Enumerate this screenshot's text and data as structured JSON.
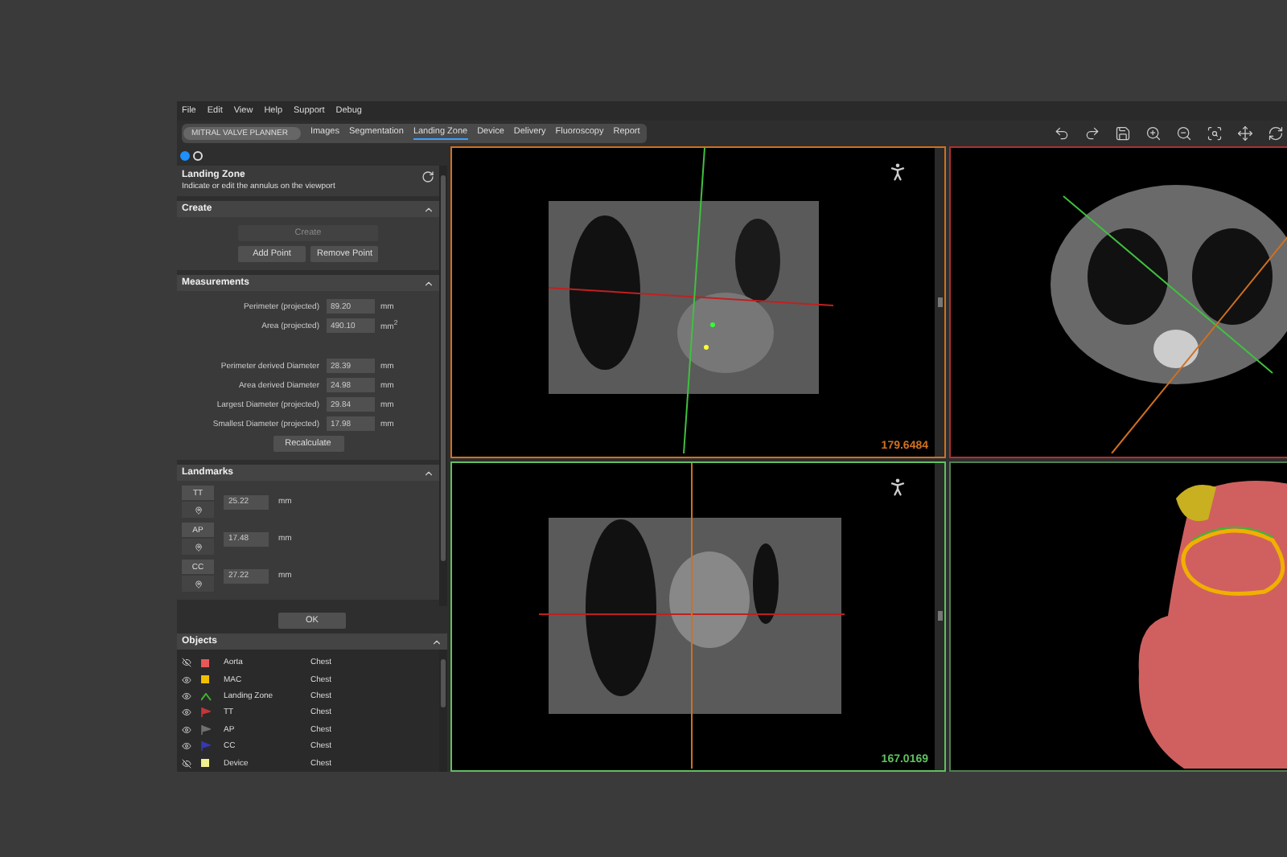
{
  "menu": [
    "File",
    "Edit",
    "View",
    "Help",
    "Support",
    "Debug"
  ],
  "workflow": {
    "title": "MITRAL VALVE PLANNER",
    "tabs": [
      {
        "label": "Images",
        "selected": false
      },
      {
        "label": "Segmentation",
        "selected": false
      },
      {
        "label": "Landing Zone",
        "selected": true
      },
      {
        "label": "Device",
        "selected": false
      },
      {
        "label": "Delivery",
        "selected": false
      },
      {
        "label": "Fluoroscopy",
        "selected": false
      },
      {
        "label": "Report",
        "selected": false
      }
    ]
  },
  "steps": [
    {
      "selected": true
    },
    {
      "selected": false
    }
  ],
  "panel": {
    "title": "Landing Zone",
    "subtitle": "Indicate or edit the annulus on the viewport"
  },
  "create": {
    "title": "Create",
    "expanded": true,
    "create_button": {
      "label": "Create",
      "disabled": true
    },
    "buttons": [
      "Add Point",
      "Remove Point"
    ]
  },
  "measurements": {
    "title": "Measurements",
    "expanded": true,
    "groups": [
      [
        {
          "label": "Perimeter (projected)",
          "value": "89.20",
          "unit": "mm"
        },
        {
          "label": "Area (projected)",
          "value": "490.10",
          "unit": "mm$^{2}$"
        }
      ],
      [
        {
          "label": "Perimeter derived Diameter",
          "value": "28.39",
          "unit": "mm"
        },
        {
          "label": "Area derived Diameter",
          "value": "24.98",
          "unit": "mm"
        },
        {
          "label": "Largest Diameter (projected)",
          "value": "29.84",
          "unit": "mm"
        },
        {
          "label": "Smallest Diameter (projected)",
          "value": "17.98",
          "unit": "mm"
        }
      ]
    ],
    "button": "Recalculate"
  },
  "landmarks": {
    "title": "Landmarks",
    "expanded": true,
    "items": [
      {
        "name": "TT",
        "value": "25.22",
        "unit": "mm"
      },
      {
        "name": "AP",
        "value": "17.48",
        "unit": "mm"
      },
      {
        "name": "CC",
        "value": "27.22",
        "unit": "mm"
      }
    ]
  },
  "ok_button": "OK",
  "objects": {
    "title": "Objects",
    "expanded": true,
    "items": [
      {
        "name": "Aorta",
        "group": "Chest",
        "kind": "swatch",
        "color": "#e85858",
        "visible": false
      },
      {
        "name": "MAC",
        "group": "Chest",
        "kind": "swatch",
        "color": "#f0c000",
        "visible": true
      },
      {
        "name": "Landing Zone",
        "group": "Chest",
        "kind": "curve",
        "color": "#40b030",
        "visible": true
      },
      {
        "name": "TT",
        "group": "Chest",
        "kind": "marker",
        "color": "#c03838",
        "visible": true
      },
      {
        "name": "AP",
        "group": "Chest",
        "kind": "marker",
        "color": "#707070",
        "visible": true
      },
      {
        "name": "CC",
        "group": "Chest",
        "kind": "marker",
        "color": "#3838b0",
        "visible": true
      },
      {
        "name": "Device",
        "group": "Chest",
        "kind": "swatch",
        "color": "#f0f090",
        "visible": false
      }
    ]
  },
  "viewports": [
    {
      "kind": "coronal",
      "color": "#d07020",
      "reading": "179.6484"
    },
    {
      "kind": "axial",
      "color": "#b03030"
    },
    {
      "kind": "sagittal",
      "color": "#60c060",
      "reading": "167.0169"
    },
    {
      "kind": "render3d",
      "color": "#508050"
    }
  ]
}
